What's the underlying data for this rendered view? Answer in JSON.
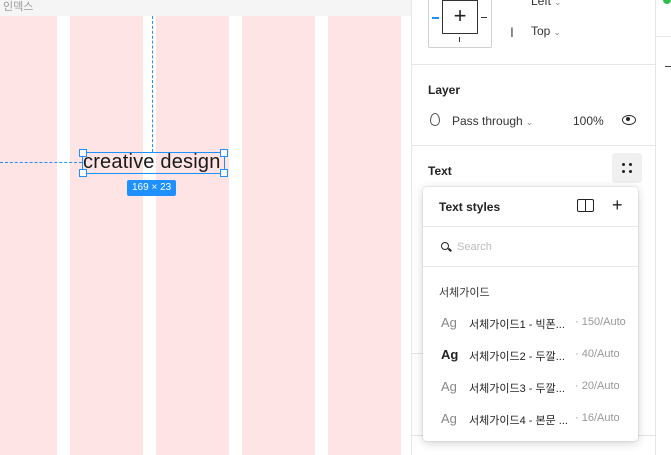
{
  "canvas": {
    "frame_label": "인덱스",
    "selected_text": "creative design",
    "size_badge": "169 × 23"
  },
  "constraints": {
    "horizontal": "Left",
    "vertical": "Top"
  },
  "layer": {
    "title": "Layer",
    "blend_mode": "Pass through",
    "opacity": "100%"
  },
  "text_section": {
    "title": "Text"
  },
  "text_styles_popover": {
    "title": "Text styles",
    "search_placeholder": "Search",
    "group": "서체가이드",
    "styles": [
      {
        "preview": "Ag",
        "name": "서체가이드1 - 빅폰...",
        "meta": "· 150/Auto"
      },
      {
        "preview": "Ag",
        "name": "서체가이드2 - 두깔...",
        "meta": "· 40/Auto"
      },
      {
        "preview": "Ag",
        "name": "서체가이드3 - 두깔...",
        "meta": "· 20/Auto"
      },
      {
        "preview": "Ag",
        "name": "서체가이드4 - 본문 ...",
        "meta": "· 16/Auto"
      }
    ]
  },
  "colors": {
    "selection": "#1e90ff",
    "column_fill": "#fee4e4"
  }
}
